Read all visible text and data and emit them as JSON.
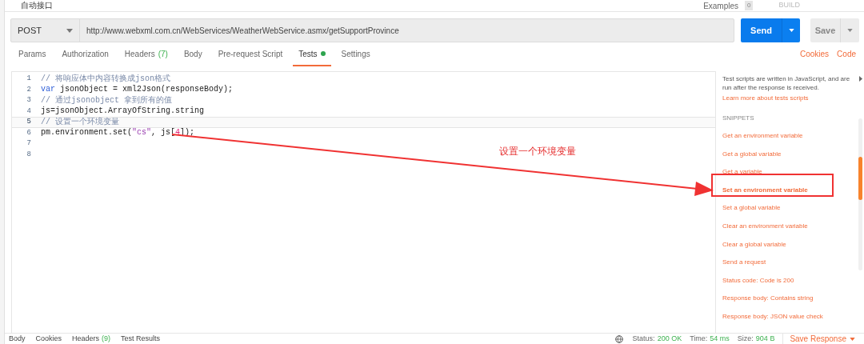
{
  "request_title": "自动接口",
  "header_actions": {
    "examples_label": "Examples",
    "examples_count": "0",
    "build_label": "BUILD"
  },
  "method": "POST",
  "url": "http://www.webxml.com.cn/WebServices/WeatherWebService.asmx/getSupportProvince",
  "buttons": {
    "send": "Send",
    "save": "Save"
  },
  "tabs": [
    {
      "label": "Params",
      "selected": false
    },
    {
      "label": "Authorization",
      "selected": false
    },
    {
      "label": "Headers",
      "count": "(7)",
      "selected": false
    },
    {
      "label": "Body",
      "selected": false
    },
    {
      "label": "Pre-request Script",
      "selected": false
    },
    {
      "label": "Tests",
      "indicator": true,
      "selected": true
    },
    {
      "label": "Settings",
      "selected": false
    }
  ],
  "links": [
    "Cookies",
    "Code"
  ],
  "code_lines": [
    {
      "number": "1",
      "current": false,
      "tokens": [
        {
          "kind": "comment",
          "text": "// 将响应体中内容转换成json格式"
        }
      ]
    },
    {
      "number": "2",
      "current": false,
      "tokens": [
        {
          "kind": "keyword",
          "text": "var"
        },
        {
          "kind": "plain",
          "text": " jsonObject = xml2Json(responseBody);"
        }
      ]
    },
    {
      "number": "3",
      "current": false,
      "tokens": [
        {
          "kind": "comment",
          "text": "// 通过jsonobject 拿到所有的值"
        }
      ]
    },
    {
      "number": "4",
      "current": false,
      "tokens": [
        {
          "kind": "plain",
          "text": "js=jsonObject.ArrayOfString.string"
        }
      ]
    },
    {
      "number": "5",
      "current": true,
      "tokens": [
        {
          "kind": "comment",
          "text": "// 设置一个环境变量"
        }
      ]
    },
    {
      "number": "6",
      "current": false,
      "tokens": [
        {
          "kind": "plain",
          "text": "pm.environment.set("
        },
        {
          "kind": "string",
          "text": "\"cs\""
        },
        {
          "kind": "plain",
          "text": ", js["
        },
        {
          "kind": "number",
          "text": "4"
        },
        {
          "kind": "plain",
          "text": "]);"
        }
      ]
    },
    {
      "number": "7",
      "current": false
    },
    {
      "number": "8",
      "current": false
    }
  ],
  "side_panel": {
    "intro": "Test scripts are written in JavaScript, and are run after the response is received.",
    "learn_link": "Learn more about tests scripts",
    "snippets_heading": "SNIPPETS",
    "snippets": [
      {
        "label": "Get an environment variable",
        "highlighted": false
      },
      {
        "label": "Get a global variable",
        "highlighted": false
      },
      {
        "label": "Get a variable",
        "highlighted": false
      },
      {
        "label": "Set an environment variable",
        "highlighted": true
      },
      {
        "label": "Set a global variable",
        "highlighted": false
      },
      {
        "label": "Clear an environment variable",
        "highlighted": false
      },
      {
        "label": "Clear a global variable",
        "highlighted": false
      },
      {
        "label": "Send a request",
        "highlighted": false
      },
      {
        "label": "Status code: Code is 200",
        "highlighted": false
      },
      {
        "label": "Response body: Contains string",
        "highlighted": false
      },
      {
        "label": "Response body: JSON value check",
        "highlighted": false
      }
    ]
  },
  "annotation": {
    "label": "设置一个环境变量"
  },
  "response_tabs": [
    {
      "label": "Body"
    },
    {
      "label": "Cookies"
    },
    {
      "label": "Headers",
      "count": "(9)"
    },
    {
      "label": "Test Results"
    }
  ],
  "response_status": {
    "status_label": "Status:",
    "status": "200 OK",
    "time_label": "Time:",
    "time": "54 ms",
    "size_label": "Size:",
    "size": "904 B",
    "save_response": "Save Response"
  }
}
